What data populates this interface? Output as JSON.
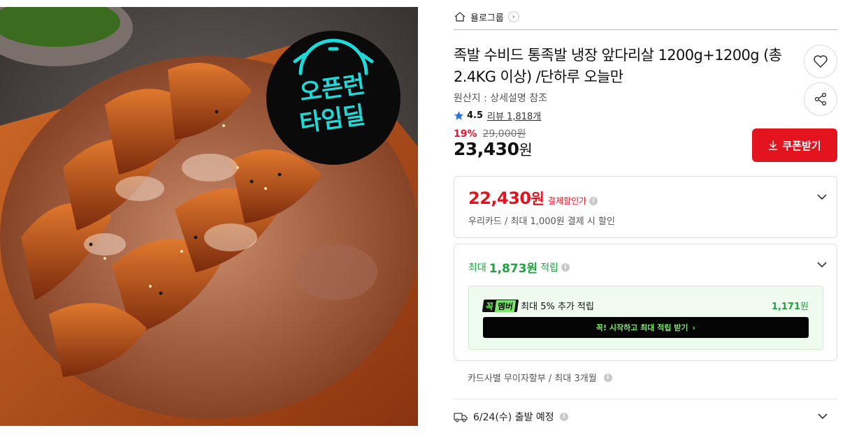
{
  "product_image": {
    "badge_line1": "오픈런",
    "badge_line2": "타임딜"
  },
  "seller": {
    "name": "욜로그룹"
  },
  "product": {
    "title": "족발 수비드 통족발 냉장 앞다리살 1200g+1200g (총 2.4KG 이상) /단하루 오늘만",
    "origin": "원산지 : 상세설명 참조",
    "rating": "4.5",
    "reviews": "리뷰 1,818개",
    "discount_rate": "19%",
    "original_price": "29,000원",
    "sale_price": "23,430",
    "sale_unit": "원"
  },
  "actions": {
    "coupon_label": "쿠폰받기",
    "wishlist_icon": "heart-icon",
    "share_icon": "share-icon"
  },
  "payment_discount": {
    "price": "22,430",
    "unit": "원",
    "label": "결제할인가",
    "note": "우리카드 / 최대 1,000원 결제 시 할인"
  },
  "points": {
    "prefix": "최대",
    "amount": "1,873원",
    "suffix": "적립",
    "member_badge": "꼭",
    "member_badge_tail": "멤버",
    "member_text": "최대 5% 추가 적립",
    "member_amount": "1,171",
    "member_unit": "원",
    "start_label": "꼭! 시작하고 최대 적립 받기",
    "start_arrow": "›"
  },
  "installment": {
    "text": "카드사별 무이자할부 / 최대 3개월"
  },
  "shipping": {
    "text": "6/24(수) 출발 예정"
  },
  "colors": {
    "accent_red": "#e4141f",
    "point_green": "#1aa63b",
    "member_green": "#7be86c"
  }
}
